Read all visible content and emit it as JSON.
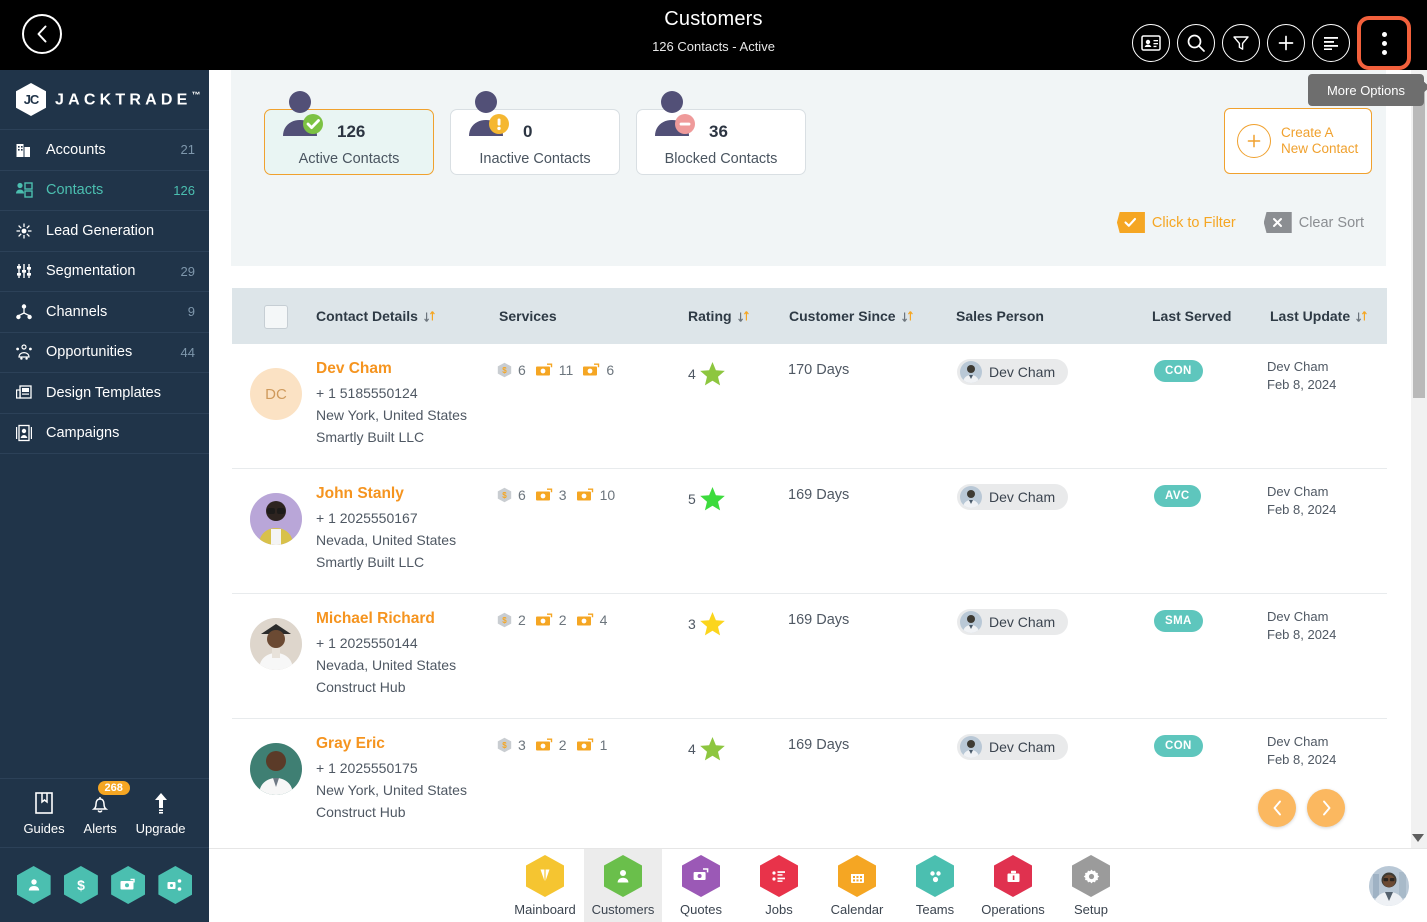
{
  "topbar": {
    "back_icon": "chevron-left-icon",
    "title": "Customers",
    "subtitle": "126 Contacts - Active",
    "icons": [
      "contact-card-icon",
      "search-icon",
      "filter-icon",
      "plus-icon",
      "list-icon",
      "more-options-icon"
    ],
    "tooltip": "More Options",
    "highlight_color": "#f2603c"
  },
  "sidebar": {
    "brand": {
      "mark": "JC",
      "name": "JACKTRADE",
      "tm": "™"
    },
    "items": [
      {
        "label": "Accounts",
        "count": "21",
        "icon": "building-icon",
        "active": false
      },
      {
        "label": "Contacts",
        "count": "126",
        "icon": "contacts-icon",
        "active": true
      },
      {
        "label": "Lead Generation",
        "count": "",
        "icon": "lead-gen-icon",
        "active": false
      },
      {
        "label": "Segmentation",
        "count": "29",
        "icon": "segmentation-icon",
        "active": false
      },
      {
        "label": "Channels",
        "count": "9",
        "icon": "channels-icon",
        "active": false
      },
      {
        "label": "Opportunities",
        "count": "44",
        "icon": "opportunities-icon",
        "active": false
      },
      {
        "label": "Design Templates",
        "count": "",
        "icon": "design-templates-icon",
        "active": false
      },
      {
        "label": "Campaigns",
        "count": "",
        "icon": "campaigns-icon",
        "active": false
      }
    ],
    "tools": [
      {
        "label": "Guides",
        "icon": "book-icon",
        "badge": ""
      },
      {
        "label": "Alerts",
        "icon": "bell-icon",
        "badge": "268"
      },
      {
        "label": "Upgrade",
        "icon": "arrow-up-icon",
        "badge": ""
      }
    ],
    "quick_hexes": [
      "person-icon",
      "dollar-icon",
      "money-transfer-icon",
      "workflow-icon"
    ],
    "accent_color": "#4bbfb0",
    "bg_color": "#203449"
  },
  "summary": {
    "cards": [
      {
        "value": "126",
        "label": "Active Contacts",
        "status_icon": "check-circle-icon",
        "status_color": "#7cc243",
        "selected": true
      },
      {
        "value": "0",
        "label": "Inactive Contacts",
        "status_icon": "warning-circle-icon",
        "status_color": "#f5b731",
        "selected": false
      },
      {
        "value": "36",
        "label": "Blocked Contacts",
        "status_icon": "block-circle-icon",
        "status_color": "#ef9a9a",
        "selected": false
      }
    ],
    "create_button": {
      "line1": "Create A",
      "line2": "New Contact",
      "icon": "plus-circle-icon"
    },
    "filter_actions": [
      {
        "label": "Click to Filter",
        "icon": "check-tag-icon",
        "color": "#f5a623"
      },
      {
        "label": "Clear Sort",
        "icon": "x-tag-icon",
        "color": "#8b8e92"
      }
    ]
  },
  "table": {
    "columns": [
      {
        "label": "Contact Details",
        "sortable": true
      },
      {
        "label": "Services",
        "sortable": false
      },
      {
        "label": "Rating",
        "sortable": true
      },
      {
        "label": "Customer Since",
        "sortable": true
      },
      {
        "label": "Sales Person",
        "sortable": false
      },
      {
        "label": "Last Served",
        "sortable": false
      },
      {
        "label": "Last Update",
        "sortable": true
      }
    ],
    "rows": [
      {
        "avatar_initials": "DC",
        "name": "Dev Cham",
        "phone": "+ 1 5185550124",
        "location": "New York, United States",
        "company": "Smartly Built LLC",
        "services": [
          {
            "icon": "hex-dollar-icon",
            "count": "6"
          },
          {
            "icon": "money-icon",
            "count": "11"
          },
          {
            "icon": "money-icon",
            "count": "6"
          }
        ],
        "rating": "4",
        "rating_color": "#8dc63f",
        "customer_since": "170 Days",
        "sales_person": "Dev Cham",
        "last_served": "CON",
        "last_update_by": "Dev Cham",
        "last_update_date": "Feb 8, 2024"
      },
      {
        "avatar_initials": "",
        "name": "John Stanly",
        "phone": "+ 1 2025550167",
        "location": "Nevada, United States",
        "company": "Smartly Built LLC",
        "services": [
          {
            "icon": "hex-dollar-icon",
            "count": "6"
          },
          {
            "icon": "money-icon",
            "count": "3"
          },
          {
            "icon": "money-icon",
            "count": "10"
          }
        ],
        "rating": "5",
        "rating_color": "#3ddb3d",
        "customer_since": "169 Days",
        "sales_person": "Dev Cham",
        "last_served": "AVC",
        "last_update_by": "Dev Cham",
        "last_update_date": "Feb 8, 2024"
      },
      {
        "avatar_initials": "",
        "name": "Michael Richard",
        "phone": "+ 1 2025550144",
        "location": "Nevada, United States",
        "company": "Construct Hub",
        "services": [
          {
            "icon": "hex-dollar-icon",
            "count": "2"
          },
          {
            "icon": "money-icon",
            "count": "2"
          },
          {
            "icon": "money-icon",
            "count": "4"
          }
        ],
        "rating": "3",
        "rating_color": "#fbd51d",
        "customer_since": "169 Days",
        "sales_person": "Dev Cham",
        "last_served": "SMA",
        "last_update_by": "Dev Cham",
        "last_update_date": "Feb 8, 2024"
      },
      {
        "avatar_initials": "",
        "name": "Gray Eric",
        "phone": "+ 1 2025550175",
        "location": "New York, United States",
        "company": "Construct Hub",
        "services": [
          {
            "icon": "hex-dollar-icon",
            "count": "3"
          },
          {
            "icon": "money-icon",
            "count": "2"
          },
          {
            "icon": "money-icon",
            "count": "1"
          }
        ],
        "rating": "4",
        "rating_color": "#8dc63f",
        "customer_since": "169 Days",
        "sales_person": "Dev Cham",
        "last_served": "CON",
        "last_update_by": "Dev Cham",
        "last_update_date": "Feb 8, 2024"
      }
    ],
    "pager": {
      "prev_icon": "chevron-left-icon",
      "next_icon": "chevron-right-icon"
    }
  },
  "bottomnav": {
    "items": [
      {
        "label": "Mainboard",
        "color": "#f5c531",
        "icon": "mainboard-icon",
        "selected": false
      },
      {
        "label": "Customers",
        "color": "#6abf4b",
        "icon": "customers-icon",
        "selected": true
      },
      {
        "label": "Quotes",
        "color": "#9b59b6",
        "icon": "quotes-icon",
        "selected": false
      },
      {
        "label": "Jobs",
        "color": "#e8334a",
        "icon": "jobs-icon",
        "selected": false
      },
      {
        "label": "Calendar",
        "color": "#f5a623",
        "icon": "calendar-icon",
        "selected": false
      },
      {
        "label": "Teams",
        "color": "#4bbfb0",
        "icon": "teams-icon",
        "selected": false
      },
      {
        "label": "Operations",
        "color": "#e0314f",
        "icon": "operations-icon",
        "selected": false
      },
      {
        "label": "Setup",
        "color": "#9b9b9b",
        "icon": "setup-icon",
        "selected": false
      }
    ],
    "user_avatar": "user-avatar-icon"
  }
}
